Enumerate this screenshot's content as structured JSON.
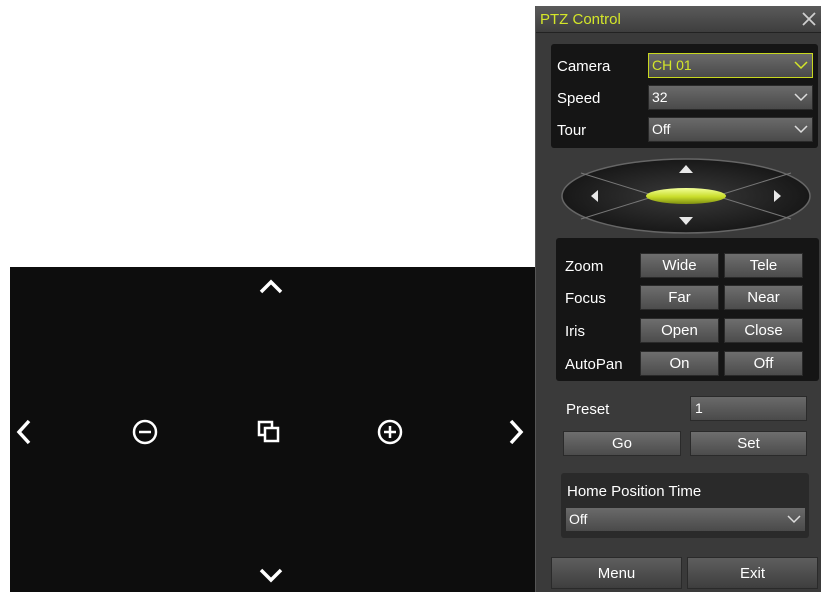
{
  "video": {
    "icons": [
      "chevron-up-icon",
      "chevron-down-icon",
      "chevron-left-icon",
      "chevron-right-icon",
      "zoom-out-icon",
      "window-icon",
      "zoom-in-icon"
    ]
  },
  "panel": {
    "title": "PTZ Control",
    "title_color": "#d4e629",
    "camera": {
      "label": "Camera",
      "value": "CH 01"
    },
    "speed": {
      "label": "Speed",
      "value": "32"
    },
    "tour": {
      "label": "Tour",
      "value": "Off"
    },
    "controls": [
      {
        "label": "Zoom",
        "a": "Wide",
        "b": "Tele"
      },
      {
        "label": "Focus",
        "a": "Far",
        "b": "Near"
      },
      {
        "label": "Iris",
        "a": "Open",
        "b": "Close"
      },
      {
        "label": "AutoPan",
        "a": "On",
        "b": "Off"
      }
    ],
    "preset": {
      "label": "Preset",
      "value": "1",
      "go": "Go",
      "set": "Set"
    },
    "home": {
      "label": "Home Position Time",
      "value": "Off"
    },
    "footer": {
      "menu": "Menu",
      "exit": "Exit"
    }
  }
}
